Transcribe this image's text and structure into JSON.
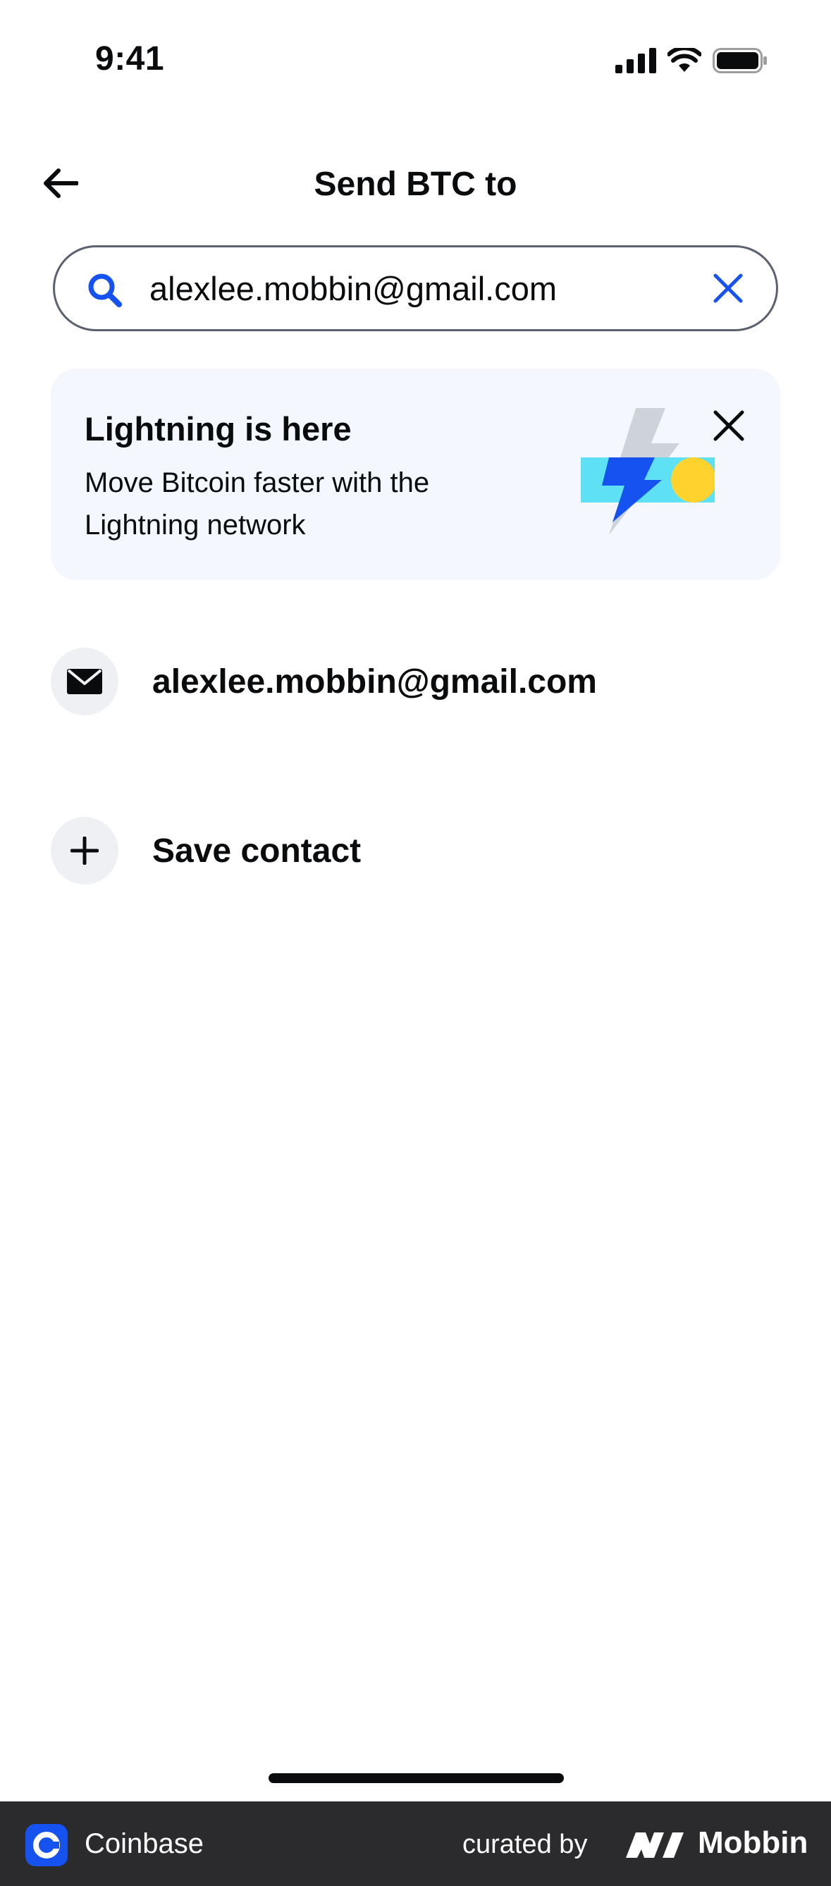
{
  "status_bar": {
    "time": "9:41"
  },
  "header": {
    "title": "Send BTC to"
  },
  "search": {
    "value": "alexlee.mobbin@gmail.com"
  },
  "promo": {
    "title": "Lightning is here",
    "body": "Move Bitcoin faster with the Lightning network"
  },
  "results": [
    {
      "label": "alexlee.mobbin@gmail.com",
      "icon": "mail-icon"
    },
    {
      "label": "Save contact",
      "icon": "plus-icon"
    }
  ],
  "footer": {
    "app_name": "Coinbase",
    "curated_by": "curated by",
    "brand": "Mobbin"
  },
  "colors": {
    "accent": "#1652f0",
    "promo_bg": "#f4f7fd",
    "icon_bg": "#eef0f3",
    "footer_bg": "#2b2b2d"
  }
}
